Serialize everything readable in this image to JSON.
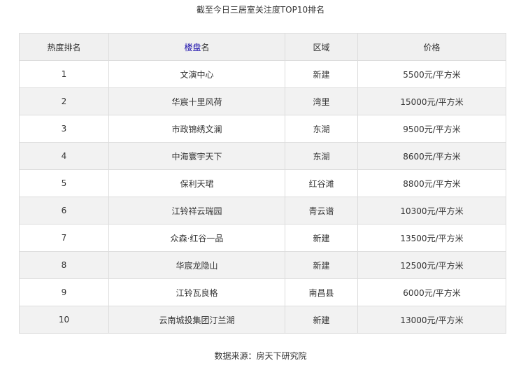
{
  "title": "截至今日三居室关注度TOP10排名",
  "table": {
    "headers": {
      "rank": "热度排名",
      "project_link": "楼盘",
      "project_suffix": "名",
      "district": "区域",
      "price": "价格"
    },
    "rows": [
      {
        "rank": "1",
        "name": "文演中心",
        "district": "新建",
        "price": "5500元/平方米"
      },
      {
        "rank": "2",
        "name": "华宸十里风荷",
        "district": "湾里",
        "price": "15000元/平方米"
      },
      {
        "rank": "3",
        "name": "市政锦绣文澜",
        "district": "东湖",
        "price": "9500元/平方米"
      },
      {
        "rank": "4",
        "name": "中海寰宇天下",
        "district": "东湖",
        "price": "8600元/平方米"
      },
      {
        "rank": "5",
        "name": "保利天珺",
        "district": "红谷滩",
        "price": "8800元/平方米"
      },
      {
        "rank": "6",
        "name": "江铃祥云瑞园",
        "district": "青云谱",
        "price": "10300元/平方米"
      },
      {
        "rank": "7",
        "name": "众森·红谷一品",
        "district": "新建",
        "price": "13500元/平方米"
      },
      {
        "rank": "8",
        "name": "华宸龙隐山",
        "district": "新建",
        "price": "12500元/平方米"
      },
      {
        "rank": "9",
        "name": "江铃瓦良格",
        "district": "南昌县",
        "price": "6000元/平方米"
      },
      {
        "rank": "10",
        "name": "云南城投集团汀兰湖",
        "district": "新建",
        "price": "13000元/平方米"
      }
    ]
  },
  "footer": "数据来源：房天下研究院",
  "colors": {
    "header_bg": "#f0f0f0",
    "stripe_bg": "#f2f2f2",
    "border": "#dddddd",
    "link": "#1a0dab"
  }
}
